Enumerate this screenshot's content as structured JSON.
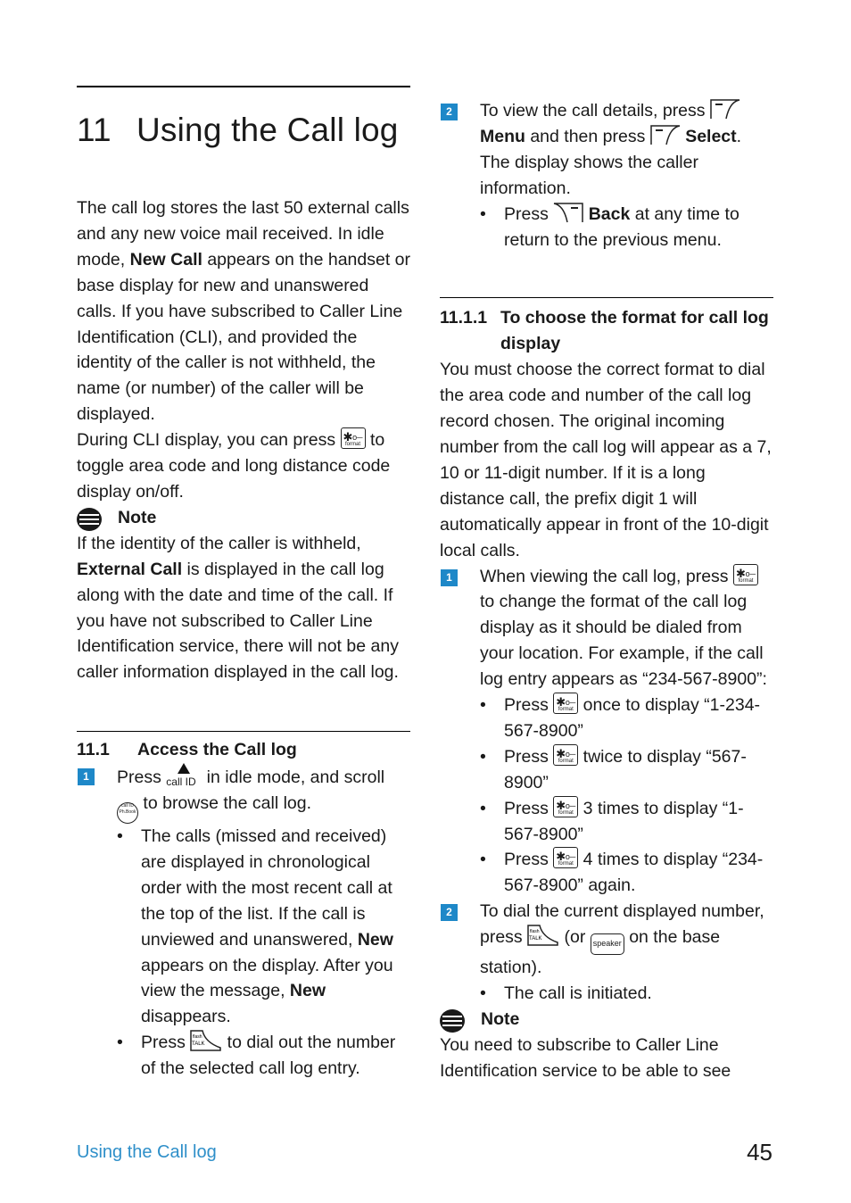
{
  "chapter": {
    "number": "11",
    "title": "Using the Call log",
    "intro": {
      "p1_a": "The call log stores the last 50 external calls and any new voice mail received. In idle mode, ",
      "p1_bold": "New Call",
      "p1_b": " appears on the handset or base display for new and unanswered calls. If you have subscribed to Caller Line Identification (CLI), and provided the identity of the caller is not withheld, the name (or number) of the caller will be displayed.",
      "p2_a": "During CLI display, you can press ",
      "p2_b": " to toggle area code and long distance code display on/off."
    },
    "note1": {
      "heading": "Note",
      "bold": "External Call",
      "text_a": "If the identity of the caller is withheld, ",
      "text_b": " is displayed in the call log along with the date and time of the call. If you have not subscribed to Caller Line Identification service, there will not be any caller information displayed in the call log."
    }
  },
  "section_11_1": {
    "number": "11.1",
    "title": "Access the Call log",
    "step1": {
      "badge": "1",
      "text_a": "Press ",
      "text_b": " in idle mode, and scroll ",
      "text_c": " to browse the call log.",
      "bullets": [
        {
          "a": "The calls (missed and received) are displayed in chronological order with the most recent call at the top of the list. If the call is unviewed and unanswered, ",
          "bold1": "New",
          "b": " appears on the display. After you view the message, ",
          "bold2": "New",
          "c": " disappears."
        },
        {
          "a": "Press ",
          "b": " to dial out the number of the selected call log entry."
        }
      ]
    },
    "step2": {
      "badge": "2",
      "a": "To view the call details, press ",
      "bold1": "Menu",
      "b": " and then press ",
      "bold2": "Select",
      "c": ". The display shows the caller information.",
      "bullet": {
        "a": "Press ",
        "bold": "Back",
        "b": " at any time to return to the previous menu."
      }
    }
  },
  "section_11_1_1": {
    "number": "11.1.1",
    "title": "To choose the format for call log display",
    "body": "You must choose the correct format to dial the area code and number of the call log record chosen. The original incoming number from the call log will appear as a 7, 10 or 11-digit number. If it is a long distance call, the prefix digit 1 will automatically appear in front of the 10-digit local calls.",
    "step1": {
      "badge": "1",
      "a": "When viewing the call log, press ",
      "b": " to change the format of the call log display as it should be dialed from your location. For example, if the call log entry appears as “234-567-8900”:",
      "bullets": [
        {
          "a": "Press ",
          "b": " once to display “1-234-567-8900”"
        },
        {
          "a": "Press ",
          "b": " twice to display “567-8900”"
        },
        {
          "a": "Press ",
          "b": " 3 times to display “1-567-8900”"
        },
        {
          "a": "Press ",
          "b": " 4 times to display “234-567-8900” again."
        }
      ]
    },
    "step2": {
      "badge": "2",
      "a": "To dial the current displayed number, press ",
      "b": " (or ",
      "c": " on the base station).",
      "bullet": "The call is initiated."
    },
    "note2": {
      "heading": "Note",
      "text": "You need to subscribe to Caller Line Identification service to be able to see"
    }
  },
  "icons": {
    "format_key": {
      "symbol": "✱",
      "lock": "o─",
      "label": "format"
    },
    "callid_key": {
      "label": "call ID"
    },
    "nav_key": {
      "top": "call ID",
      "bottom": "Ph.Book"
    },
    "talk_key": {
      "label_top": "flash",
      "label": "TALK"
    },
    "speaker_key": {
      "label": "speaker"
    }
  },
  "footer": {
    "section_title": "Using the Call log",
    "page_number": "45"
  },
  "colors": {
    "accent": "#2e8fc9",
    "badge": "#1e88c8",
    "text": "#1a1a1a"
  }
}
